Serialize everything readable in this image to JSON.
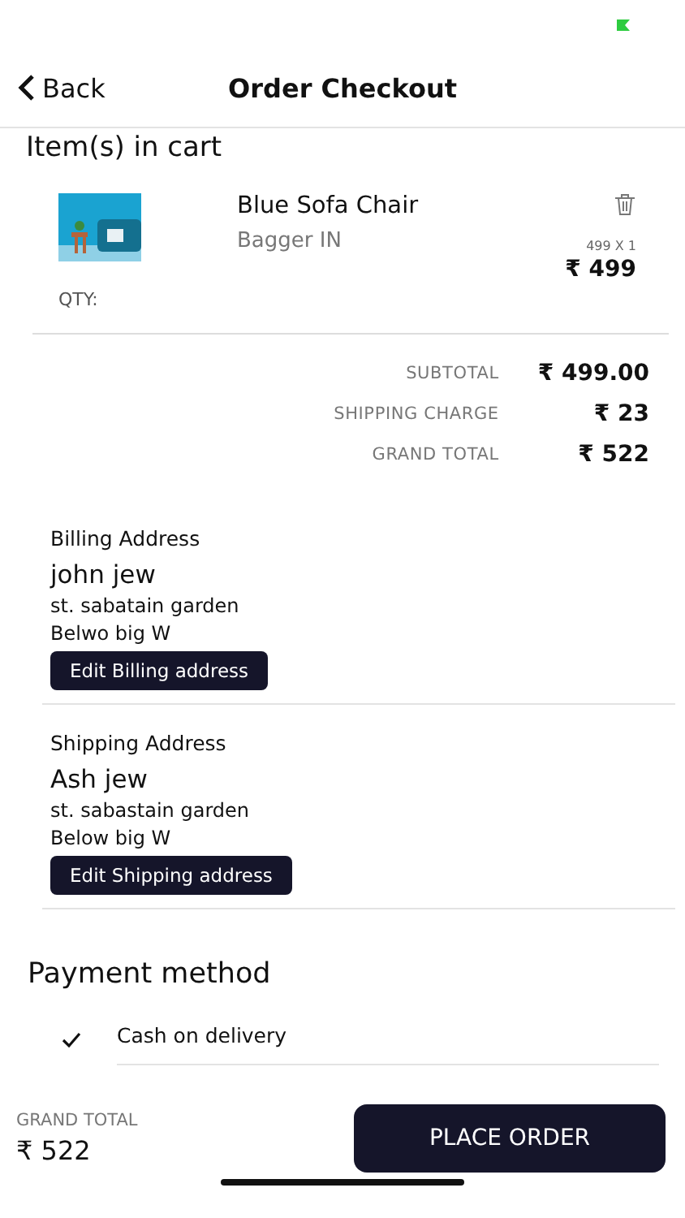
{
  "header": {
    "back": "Back",
    "title": "Order Checkout"
  },
  "cart": {
    "heading": "Item(s) in cart",
    "items": [
      {
        "name": "Blue Sofa Chair",
        "seller": "Bagger IN",
        "qty_label": "QTY:",
        "unit": "499 X 1",
        "price": "₹ 499"
      }
    ]
  },
  "summary": [
    {
      "label": "SUBTOTAL",
      "value": "₹ 499.00"
    },
    {
      "label": "SHIPPING CHARGE",
      "value": "₹ 23"
    },
    {
      "label": "GRAND TOTAL",
      "value": "₹ 522"
    }
  ],
  "addresses": [
    {
      "heading": "Billing Address",
      "name": "john jew",
      "line1": "st. sabatain garden",
      "line2": "Belwo big W",
      "button": "Edit Billing address"
    },
    {
      "heading": "Shipping Address",
      "name": "Ash jew",
      "line1": "st. sabastain garden",
      "line2": "Below big W",
      "button": "Edit Shipping address"
    }
  ],
  "payment": {
    "heading": "Payment method",
    "options": [
      {
        "label": "Cash on delivery",
        "selected": true
      }
    ]
  },
  "footer": {
    "label": "GRAND TOTAL",
    "total": "₹ 522",
    "button": "PLACE ORDER"
  }
}
